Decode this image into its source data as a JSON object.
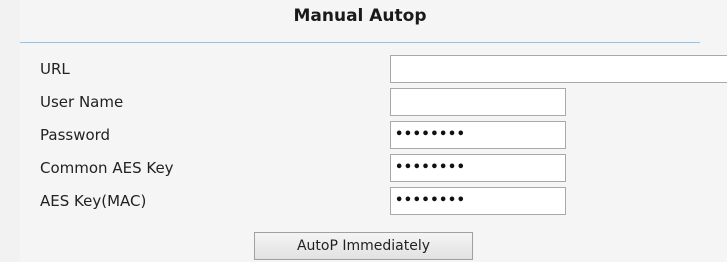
{
  "section": {
    "title": "Manual Autop"
  },
  "fields": {
    "url": {
      "label": "URL",
      "value": ""
    },
    "username": {
      "label": "User Name",
      "value": ""
    },
    "password": {
      "label": "Password",
      "value": "••••••••"
    },
    "common_aes_key": {
      "label": "Common AES Key",
      "value": "••••••••"
    },
    "aes_key_mac": {
      "label": "AES Key(MAC)",
      "value": "••••••••"
    }
  },
  "actions": {
    "autop_immediately_label": "AutoP Immediately"
  }
}
